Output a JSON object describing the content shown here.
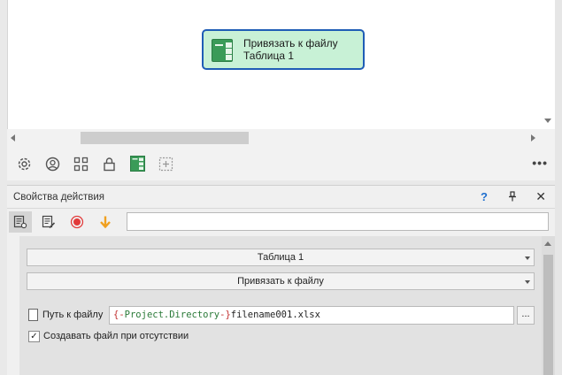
{
  "canvas": {
    "node": {
      "title": "Привязать к файлу",
      "subtitle": "Таблица 1",
      "icon": "table-icon"
    }
  },
  "toolbar": {
    "icons": [
      "gear-icon",
      "user-circle-icon",
      "grid-icon",
      "lock-icon",
      "table-icon",
      "add-box-icon"
    ],
    "more_label": "•••"
  },
  "properties": {
    "title": "Свойства действия",
    "help_label": "?",
    "pin_label": "📌",
    "close_label": "✕",
    "tools": [
      "properties-icon",
      "edit-properties-icon",
      "record-icon",
      "arrow-down-icon"
    ],
    "search_value": "",
    "table_select": "Таблица 1",
    "action_select": "Привязать к файлу",
    "path_label": "Путь к файлу",
    "path_value": {
      "open_brace": "{-",
      "variable": "Project.Directory",
      "close_brace": "-}",
      "rest": "filename001.xlsx"
    },
    "browse_label": "...",
    "create_checkbox": {
      "label": "Создавать файл при отсутствии",
      "checked": true,
      "mark": "✓"
    }
  },
  "colors": {
    "node_fill": "#c8f1d6",
    "node_border": "#1f5db6",
    "table_green": "#3a9b58",
    "help_blue": "#1f6fce",
    "record_red": "#e23a3a",
    "arrow_orange": "#f0a020"
  }
}
